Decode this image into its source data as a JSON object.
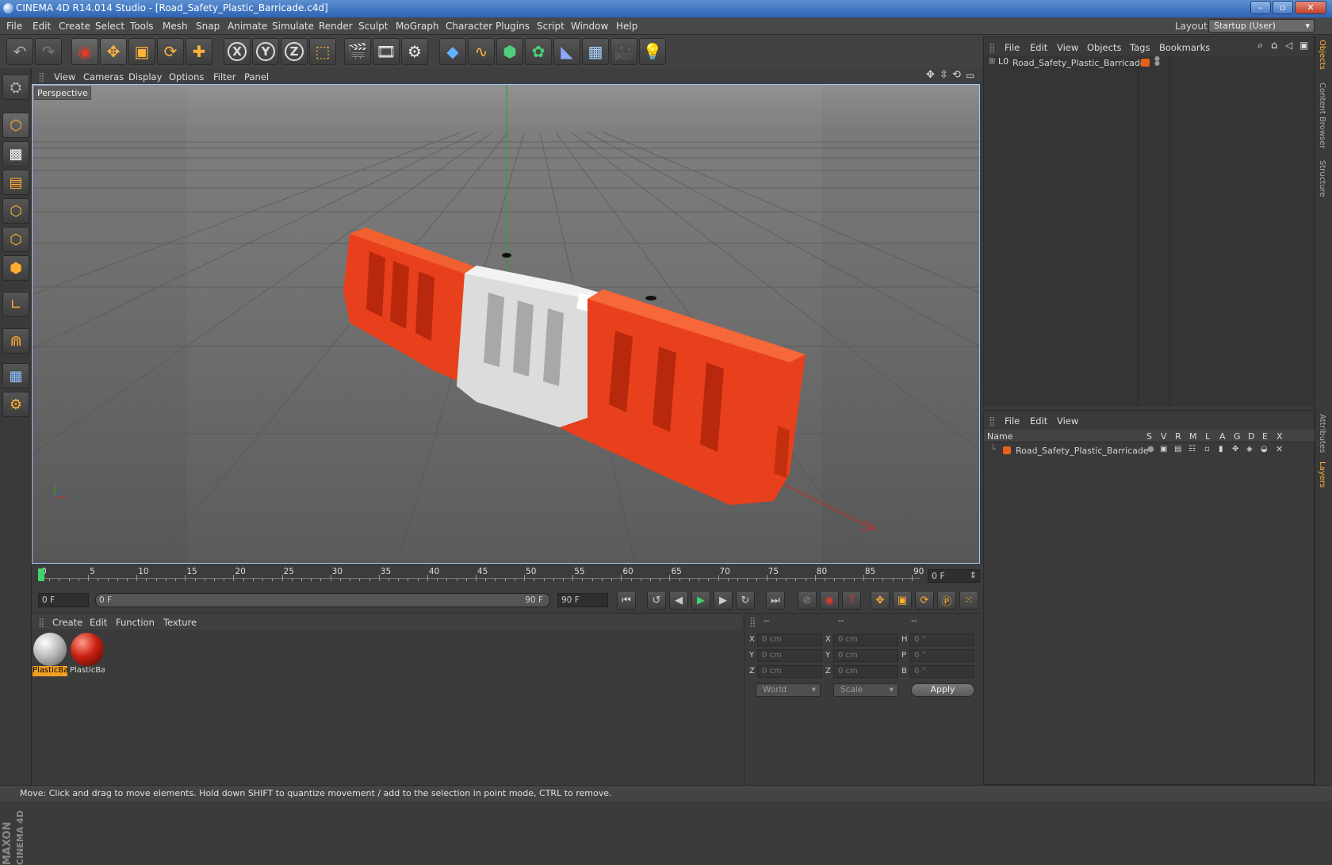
{
  "window": {
    "title": "CINEMA 4D R14.014 Studio - [Road_Safety_Plastic_Barricade.c4d]"
  },
  "menu": [
    "File",
    "Edit",
    "Create",
    "Select",
    "Tools",
    "Mesh",
    "Snap",
    "Animate",
    "Simulate",
    "Render",
    "Sculpt",
    "MoGraph",
    "Character",
    "Plugins",
    "Script",
    "Window",
    "Help"
  ],
  "layout": {
    "label": "Layout:",
    "value": "Startup (User)"
  },
  "toolbar": {
    "icons": [
      "undo-icon",
      "redo-icon",
      "live-selection-icon",
      "move-icon",
      "scale-icon",
      "rotate-icon",
      "add-icon",
      "x-axis-icon",
      "y-axis-icon",
      "z-axis-icon",
      "coordinate-system-icon",
      "render-view-icon",
      "render-picture-viewer-icon",
      "render-settings-icon",
      "cube-icon",
      "spline-icon",
      "subdivision-icon",
      "cloner-icon",
      "deformer-icon",
      "floor-icon",
      "camera-icon",
      "light-icon"
    ],
    "axis_x": "X",
    "axis_y": "Y",
    "axis_z": "Z"
  },
  "viewport": {
    "menu": [
      "View",
      "Cameras",
      "Display",
      "Options",
      "Filter",
      "Panel"
    ],
    "label": "Perspective",
    "colors": {
      "barrier_red": "#e8401c",
      "barrier_white": "#dcdcdc"
    }
  },
  "timeline": {
    "ticks": [
      "0",
      "5",
      "10",
      "15",
      "20",
      "25",
      "30",
      "35",
      "40",
      "45",
      "50",
      "55",
      "60",
      "65",
      "70",
      "75",
      "80",
      "85",
      "90"
    ],
    "current_frame": "0 F"
  },
  "transport": {
    "start": "0 F",
    "range_start": "0 F",
    "range_end": "90 F",
    "end": "90 F"
  },
  "materials": {
    "menu": [
      "Create",
      "Edit",
      "Function",
      "Texture"
    ],
    "items": [
      {
        "label": "PlasticBa",
        "color": "#d8d8d8",
        "selected": true
      },
      {
        "label": "PlasticBa",
        "color": "#c81f10",
        "selected": false
      }
    ]
  },
  "coordinates": {
    "headers": [
      "--",
      "--",
      "--"
    ],
    "rows": [
      {
        "l1": "X",
        "v1": "0 cm",
        "l2": "X",
        "v2": "0 cm",
        "l3": "H",
        "v3": "0 °"
      },
      {
        "l1": "Y",
        "v1": "0 cm",
        "l2": "Y",
        "v2": "0 cm",
        "l3": "P",
        "v3": "0 °"
      },
      {
        "l1": "Z",
        "v1": "0 cm",
        "l2": "Z",
        "v2": "0 cm",
        "l3": "B",
        "v3": "0 °"
      }
    ],
    "space": "World",
    "mode": "Scale",
    "apply": "Apply"
  },
  "objects": {
    "menu": [
      "File",
      "Edit",
      "View",
      "Objects",
      "Tags",
      "Bookmarks"
    ],
    "items": [
      {
        "name": "Road_Safety_Plastic_Barricade"
      }
    ]
  },
  "layers": {
    "menu": [
      "File",
      "Edit",
      "View"
    ],
    "columns": [
      "Name",
      "S",
      "V",
      "R",
      "M",
      "L",
      "A",
      "G",
      "D",
      "E",
      "X"
    ],
    "items": [
      {
        "name": "Road_Safety_Plastic_Barricade",
        "color": "#e8601c"
      }
    ]
  },
  "side_tabs": [
    "Objects",
    "Content Browser",
    "Structure",
    "Attributes",
    "Layers"
  ],
  "brand": {
    "maxon": "MAXON",
    "cinema": "CINEMA 4D"
  },
  "status": "Move: Click and drag to move elements. Hold down SHIFT to quantize movement / add to the selection in point mode, CTRL to remove."
}
